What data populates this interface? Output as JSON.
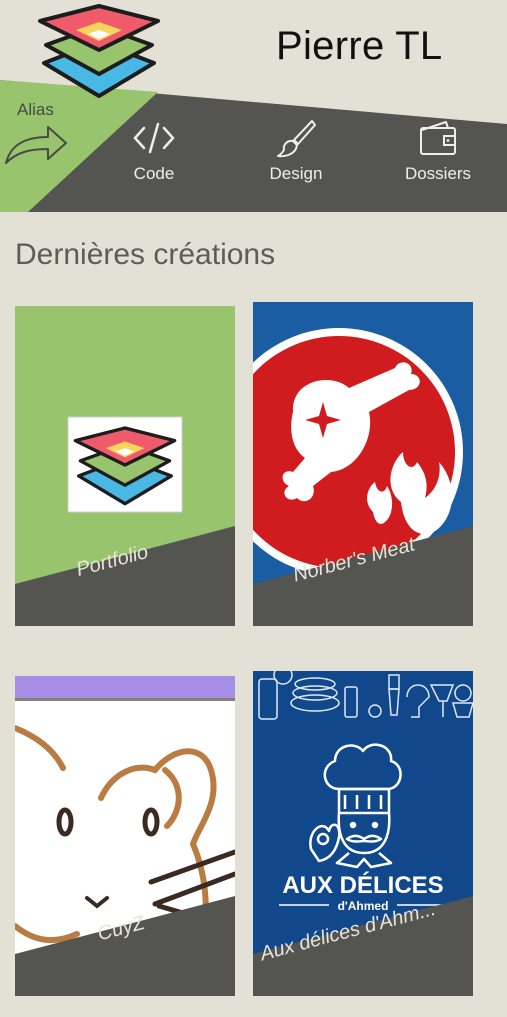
{
  "header": {
    "title": "Pierre TL",
    "alias_label": "Alias",
    "nav": [
      {
        "label": "Code",
        "icon": "code-icon"
      },
      {
        "label": "Design",
        "icon": "brush-icon"
      },
      {
        "label": "Dossiers",
        "icon": "wallet-icon"
      }
    ]
  },
  "section": {
    "title": "Dernières créations"
  },
  "cards": [
    {
      "caption": "Portfolio"
    },
    {
      "caption": "Norber's Meat"
    },
    {
      "caption": "CuyZ"
    },
    {
      "caption": "Aux délices d'Ahm...",
      "poster_title": "AUX DÉLICES",
      "poster_subtitle": "d'Ahmed"
    }
  ],
  "colors": {
    "background": "#e3e0d5",
    "green": "#97c46d",
    "dark": "#545550",
    "red": "#d11c1f",
    "blue": "#1a5da3",
    "purple": "#a88ee6"
  }
}
